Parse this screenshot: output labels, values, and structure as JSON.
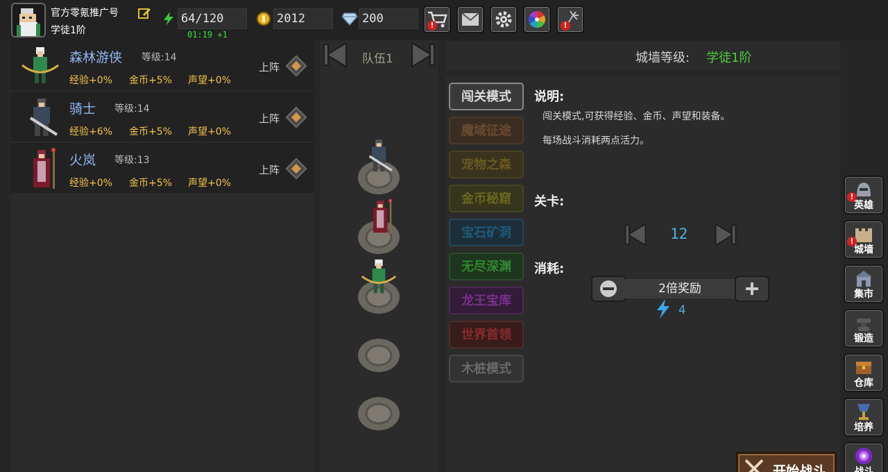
{
  "player": {
    "name": "官方零氪推广号",
    "rank": "学徒1阶"
  },
  "resources": {
    "energy": "64/120",
    "energy_timer": "01:19 +1",
    "gold": "2012",
    "gems": "200"
  },
  "top_icons": [
    "shop-cart-icon",
    "mail-icon",
    "settings-gear-icon",
    "color-wheel-icon",
    "fireworks-icon"
  ],
  "heroes": [
    {
      "name": "森林游侠",
      "level_label": "等级:14",
      "exp": "经验+0%",
      "gold": "金币+5%",
      "fame": "声望+0%",
      "action": "上阵"
    },
    {
      "name": "骑士",
      "level_label": "等级:14",
      "exp": "经验+6%",
      "gold": "金币+5%",
      "fame": "声望+0%",
      "action": "上阵"
    },
    {
      "name": "火岚",
      "level_label": "等级:13",
      "exp": "经验+0%",
      "gold": "金币+5%",
      "fame": "声望+0%",
      "action": "上阵"
    }
  ],
  "team": {
    "label": "队伍1"
  },
  "city": {
    "label": "城墙等级:",
    "value": "学徒1阶"
  },
  "modes": [
    {
      "label": "闯关模式",
      "color": "#dcdcdc",
      "bg": "#3a3a3a",
      "border": "#8a8a8a"
    },
    {
      "label": "魔域征途",
      "color": "#6b4b30",
      "bg": "#3a2e22",
      "border": "#4a3a2a"
    },
    {
      "label": "宠物之森",
      "color": "#6a5a20",
      "bg": "#38321e",
      "border": "#4a4222"
    },
    {
      "label": "金币秘窟",
      "color": "#686820",
      "bg": "#36361c",
      "border": "#464622"
    },
    {
      "label": "宝石矿洞",
      "color": "#1f5a7a",
      "bg": "#1c2e3a",
      "border": "#24465a"
    },
    {
      "label": "无尽深渊",
      "color": "#2f8a2f",
      "bg": "#1d361d",
      "border": "#2a4e2a"
    },
    {
      "label": "龙王宝库",
      "color": "#7a2f8a",
      "bg": "#321c38",
      "border": "#4a2a52"
    },
    {
      "label": "世界首领",
      "color": "#8a2a2a",
      "bg": "#381c1c",
      "border": "#522a2a"
    },
    {
      "label": "木桩模式",
      "color": "#6a6a6a",
      "bg": "#333333",
      "border": "#484848"
    }
  ],
  "info": {
    "title": "说明:",
    "line1": "闯关模式,可获得经验、金币、声望和装备。",
    "line2": "每场战斗消耗两点活力。",
    "stage_label": "关卡:",
    "stage": "12",
    "cost_label": "消耗:",
    "reward": "2倍奖励",
    "energy_cost": "4",
    "start": "开始战斗"
  },
  "sidebar": [
    {
      "label": "英雄",
      "icon": "helmet-icon",
      "alert": true
    },
    {
      "label": "城墙",
      "icon": "castle-wall-icon",
      "alert": true
    },
    {
      "label": "集市",
      "icon": "market-icon",
      "alert": false
    },
    {
      "label": "锻造",
      "icon": "anvil-icon",
      "alert": false
    },
    {
      "label": "仓库",
      "icon": "treasure-chest-icon",
      "alert": false
    },
    {
      "label": "培养",
      "icon": "chalice-icon",
      "alert": false
    },
    {
      "label": "战斗",
      "icon": "portal-icon",
      "alert": false
    }
  ]
}
